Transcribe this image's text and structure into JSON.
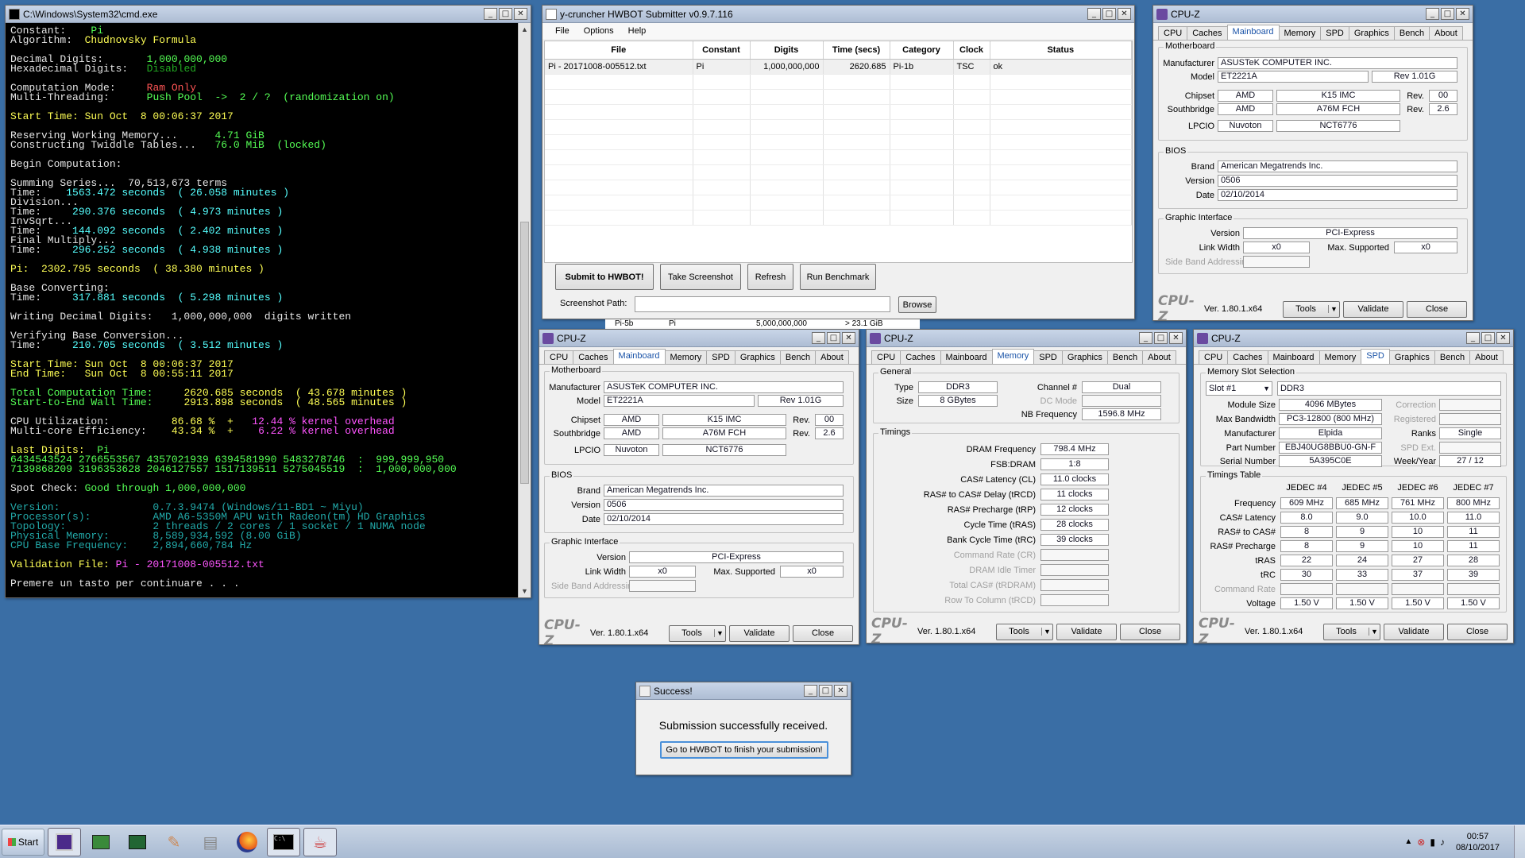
{
  "desktop_color": "#3a6ea5",
  "cmd": {
    "title": "C:\\Windows\\System32\\cmd.exe",
    "lines": [
      [
        {
          "t": "Constant:    ",
          "c": "w"
        },
        {
          "t": "Pi",
          "c": "g"
        }
      ],
      [
        {
          "t": "Algorithm:  ",
          "c": "w"
        },
        {
          "t": "Chudnovsky Formula",
          "c": "y"
        }
      ],
      [],
      [
        {
          "t": "Decimal Digits:       ",
          "c": "w"
        },
        {
          "t": "1,000,000,000",
          "c": "g"
        }
      ],
      [
        {
          "t": "Hexadecimal Digits:   ",
          "c": "w"
        },
        {
          "t": "Disabled",
          "c": "dg"
        }
      ],
      [],
      [
        {
          "t": "Computation Mode:     ",
          "c": "w"
        },
        {
          "t": "Ram Only",
          "c": "r"
        }
      ],
      [
        {
          "t": "Multi-Threading:      ",
          "c": "w"
        },
        {
          "t": "Push Pool  ->  2 / ?  (randomization on)",
          "c": "g"
        }
      ],
      [],
      [
        {
          "t": "Start Time: Sun Oct  8 00:06:37 2017",
          "c": "y"
        }
      ],
      [],
      [
        {
          "t": "Reserving Working Memory...      ",
          "c": "w"
        },
        {
          "t": "4.71 GiB",
          "c": "g"
        }
      ],
      [
        {
          "t": "Constructing Twiddle Tables...   ",
          "c": "w"
        },
        {
          "t": "76.0 MiB  (locked)",
          "c": "g"
        }
      ],
      [],
      [
        {
          "t": "Begin Computation:",
          "c": "w"
        }
      ],
      [],
      [
        {
          "t": "Summing Series...  70,513,673 terms",
          "c": "w"
        }
      ],
      [
        {
          "t": "Time:    ",
          "c": "w"
        },
        {
          "t": "1563.472 seconds  ( 26.058 minutes )",
          "c": "c"
        }
      ],
      [
        {
          "t": "Division...",
          "c": "w"
        }
      ],
      [
        {
          "t": "Time:     ",
          "c": "w"
        },
        {
          "t": "290.376 seconds  ( 4.973 minutes )",
          "c": "c"
        }
      ],
      [
        {
          "t": "InvSqrt...",
          "c": "w"
        }
      ],
      [
        {
          "t": "Time:     ",
          "c": "w"
        },
        {
          "t": "144.092 seconds  ( 2.402 minutes )",
          "c": "c"
        }
      ],
      [
        {
          "t": "Final Multiply...",
          "c": "w"
        }
      ],
      [
        {
          "t": "Time:     ",
          "c": "w"
        },
        {
          "t": "296.252 seconds  ( 4.938 minutes )",
          "c": "c"
        }
      ],
      [],
      [
        {
          "t": "Pi:  2302.795 seconds  ( 38.380 minutes )",
          "c": "y"
        }
      ],
      [],
      [
        {
          "t": "Base Converting:",
          "c": "w"
        }
      ],
      [
        {
          "t": "Time:     ",
          "c": "w"
        },
        {
          "t": "317.881 seconds  ( 5.298 minutes )",
          "c": "c"
        }
      ],
      [],
      [
        {
          "t": "Writing Decimal Digits:   1,000,000,000  digits written",
          "c": "w"
        }
      ],
      [],
      [
        {
          "t": "Verifying Base Conversion...",
          "c": "w"
        }
      ],
      [
        {
          "t": "Time:     ",
          "c": "w"
        },
        {
          "t": "210.705 seconds  ( 3.512 minutes )",
          "c": "c"
        }
      ],
      [],
      [
        {
          "t": "Start Time: Sun Oct  8 00:06:37 2017",
          "c": "y"
        }
      ],
      [
        {
          "t": "End Time:   Sun Oct  8 00:55:11 2017",
          "c": "y"
        }
      ],
      [],
      [
        {
          "t": "Total Computation Time:     ",
          "c": "g"
        },
        {
          "t": "2620.685 seconds  ( 43.678 minutes )",
          "c": "y"
        }
      ],
      [
        {
          "t": "Start-to-End Wall Time:     ",
          "c": "g"
        },
        {
          "t": "2913.898 seconds  ( 48.565 minutes )",
          "c": "y"
        }
      ],
      [],
      [
        {
          "t": "CPU Utilization:          ",
          "c": "w"
        },
        {
          "t": "86.68 %  +   ",
          "c": "y"
        },
        {
          "t": "12.44 % kernel overhead",
          "c": "m"
        }
      ],
      [
        {
          "t": "Multi-core Efficiency:    ",
          "c": "w"
        },
        {
          "t": "43.34 %  +    ",
          "c": "y"
        },
        {
          "t": "6.22 % kernel overhead",
          "c": "m"
        }
      ],
      [],
      [
        {
          "t": "Last Digits:  ",
          "c": "y"
        },
        {
          "t": "Pi",
          "c": "g"
        }
      ],
      [
        {
          "t": "6434543524 2766553567 4357021939 6394581990 5483278746  :  999,999,950",
          "c": "g"
        }
      ],
      [
        {
          "t": "7139868209 3196353628 2046127557 1517139511 5275045519  :  1,000,000,000",
          "c": "g"
        }
      ],
      [],
      [
        {
          "t": "Spot Check: ",
          "c": "w"
        },
        {
          "t": "Good through 1,000,000,000",
          "c": "g"
        }
      ],
      [],
      [
        {
          "t": "Version:               0.7.3.9474 (Windows/11-BD1 ~ Miyu)",
          "c": "dc"
        }
      ],
      [
        {
          "t": "Processor(s):          AMD A6-5350M APU with Radeon(tm) HD Graphics",
          "c": "dc"
        }
      ],
      [
        {
          "t": "Topology:              2 threads / 2 cores / 1 socket / 1 NUMA node",
          "c": "dc"
        }
      ],
      [
        {
          "t": "Physical Memory:       8,589,934,592 (8.00 GiB)",
          "c": "dc"
        }
      ],
      [
        {
          "t": "CPU Base Frequency:    2,894,660,784 Hz",
          "c": "dc"
        }
      ],
      [],
      [
        {
          "t": "Validation File: ",
          "c": "y"
        },
        {
          "t": "Pi - 20171008-005512.txt",
          "c": "m"
        }
      ],
      [],
      [
        {
          "t": "Premere un tasto per continuare . . .",
          "c": "w"
        }
      ]
    ]
  },
  "submitter": {
    "title": "y-cruncher HWBOT Submitter v0.9.7.116",
    "menus": [
      "File",
      "Options",
      "Help"
    ],
    "columns": [
      "File",
      "Constant",
      "Digits",
      "Time (secs)",
      "Category",
      "Clock",
      "Status"
    ],
    "rows": [
      [
        "Pi - 20171008-005512.txt",
        "Pi",
        "1,000,000,000",
        "2620.685",
        "Pi-1b",
        "TSC",
        "ok"
      ]
    ],
    "buttons": {
      "submit": "Submit to HWBOT!",
      "screenshot": "Take Screenshot",
      "refresh": "Refresh",
      "run": "Run Benchmark",
      "browse": "Browse"
    },
    "path_label": "Screenshot Path:",
    "path_value": "",
    "behind_row": [
      "Pi-5b",
      "Pi",
      "5,000,000,000",
      "> 23.1 GiB"
    ]
  },
  "cpuz_tabs": [
    "CPU",
    "Caches",
    "Mainboard",
    "Memory",
    "SPD",
    "Graphics",
    "Bench",
    "About"
  ],
  "cpuz_common": {
    "title": "CPU-Z",
    "logo": "CPU-Z",
    "version": "Ver. 1.80.1.x64",
    "tools": "Tools",
    "validate": "Validate",
    "close": "Close"
  },
  "mainboard": {
    "g_mb": "Motherboard",
    "g_bios": "BIOS",
    "g_gi": "Graphic Interface",
    "l_manufacturer": "Manufacturer",
    "l_model": "Model",
    "l_chipset": "Chipset",
    "l_southbridge": "Southbridge",
    "l_lpcio": "LPCIO",
    "l_rev": "Rev.",
    "manufacturer": "ASUSTeK COMPUTER INC.",
    "model": "ET2221A",
    "model_rev": "Rev 1.01G",
    "chipset_vendor": "AMD",
    "chipset_model": "K15 IMC",
    "chipset_rev": "00",
    "sb_vendor": "AMD",
    "sb_model": "A76M FCH",
    "sb_rev": "2.6",
    "lpcio_vendor": "Nuvoton",
    "lpcio_model": "NCT6776",
    "l_brand": "Brand",
    "l_version": "Version",
    "l_date": "Date",
    "bios_brand": "American Megatrends Inc.",
    "bios_version": "0506",
    "bios_date": "02/10/2014",
    "l_gi_version": "Version",
    "l_link_width": "Link Width",
    "l_max_supported": "Max. Supported",
    "l_sba": "Side Band Addressing",
    "gi_version": "PCI-Express",
    "link_width": "x0",
    "max_supported": "x0"
  },
  "memory": {
    "g_general": "General",
    "g_timings": "Timings",
    "l_type": "Type",
    "l_size": "Size",
    "l_channel": "Channel #",
    "l_dc": "DC Mode",
    "l_nb": "NB Frequency",
    "type": "DDR3",
    "size": "8 GBytes",
    "channel": "Dual",
    "nb_freq": "1596.8 MHz",
    "timings": [
      {
        "label": "DRAM Frequency",
        "value": "798.4 MHz",
        "dis": false
      },
      {
        "label": "FSB:DRAM",
        "value": "1:8",
        "dis": false
      },
      {
        "label": "CAS# Latency (CL)",
        "value": "11.0 clocks",
        "dis": false
      },
      {
        "label": "RAS# to CAS# Delay (tRCD)",
        "value": "11 clocks",
        "dis": false
      },
      {
        "label": "RAS# Precharge (tRP)",
        "value": "12 clocks",
        "dis": false
      },
      {
        "label": "Cycle Time (tRAS)",
        "value": "28 clocks",
        "dis": false
      },
      {
        "label": "Bank Cycle Time (tRC)",
        "value": "39 clocks",
        "dis": false
      },
      {
        "label": "Command Rate (CR)",
        "value": "",
        "dis": true
      },
      {
        "label": "DRAM Idle Timer",
        "value": "",
        "dis": true
      },
      {
        "label": "Total CAS# (tRDRAM)",
        "value": "",
        "dis": true
      },
      {
        "label": "Row To Column (tRCD)",
        "value": "",
        "dis": true
      }
    ]
  },
  "spd": {
    "g_slot": "Memory Slot Selection",
    "g_tt": "Timings Table",
    "slot": "Slot #1",
    "slot_type": "DDR3",
    "l_module_size": "Module Size",
    "l_max_bw": "Max Bandwidth",
    "l_manufacturer": "Manufacturer",
    "l_part": "Part Number",
    "l_serial": "Serial Number",
    "l_correction": "Correction",
    "l_registered": "Registered",
    "l_ranks": "Ranks",
    "l_spd_ext": "SPD Ext.",
    "l_week": "Week/Year",
    "module_size": "4096 MBytes",
    "max_bw": "PC3-12800 (800 MHz)",
    "manufacturer": "Elpida",
    "part": "EBJ40UG8BBU0-GN-F",
    "serial": "5A395C0E",
    "ranks": "Single",
    "week": "27 / 12",
    "jedec": [
      "JEDEC #4",
      "JEDEC #5",
      "JEDEC #6",
      "JEDEC #7"
    ],
    "rows": [
      {
        "label": "Frequency",
        "vals": [
          "609 MHz",
          "685 MHz",
          "761 MHz",
          "800 MHz"
        ],
        "dis": false
      },
      {
        "label": "CAS# Latency",
        "vals": [
          "8.0",
          "9.0",
          "10.0",
          "11.0"
        ],
        "dis": false
      },
      {
        "label": "RAS# to CAS#",
        "vals": [
          "8",
          "9",
          "10",
          "11"
        ],
        "dis": false
      },
      {
        "label": "RAS# Precharge",
        "vals": [
          "8",
          "9",
          "10",
          "11"
        ],
        "dis": false
      },
      {
        "label": "tRAS",
        "vals": [
          "22",
          "24",
          "27",
          "28"
        ],
        "dis": false
      },
      {
        "label": "tRC",
        "vals": [
          "30",
          "33",
          "37",
          "39"
        ],
        "dis": false
      },
      {
        "label": "Command Rate",
        "vals": [
          "",
          "",
          "",
          ""
        ],
        "dis": true
      },
      {
        "label": "Voltage",
        "vals": [
          "1.50 V",
          "1.50 V",
          "1.50 V",
          "1.50 V"
        ],
        "dis": false
      }
    ]
  },
  "dialog": {
    "title": "Success!",
    "message": "Submission successfully received.",
    "button": "Go to HWBOT to finish your submission!"
  },
  "taskbar": {
    "start": "Start",
    "time": "00:57",
    "date": "08/10/2017"
  }
}
